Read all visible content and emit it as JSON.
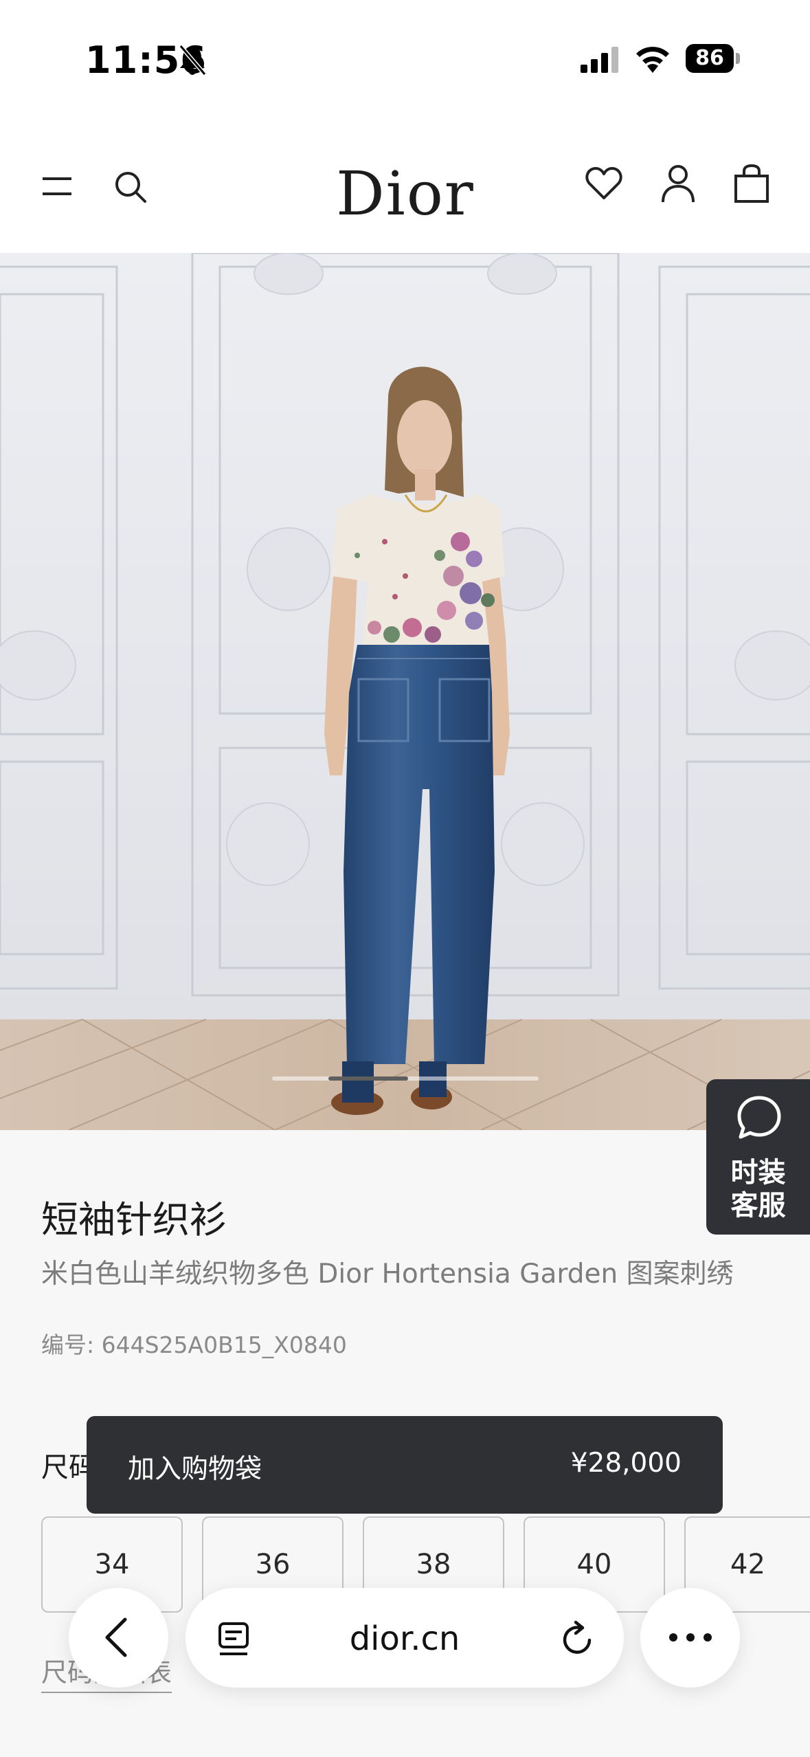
{
  "status_bar": {
    "time": "11:56",
    "battery": "86"
  },
  "header": {
    "logo": "Dior",
    "icons": [
      "menu-icon",
      "search-icon",
      "heart-icon",
      "user-icon",
      "bag-icon"
    ]
  },
  "hero": {
    "carousel_position": 0.3
  },
  "chat": {
    "label": "时装\n客服"
  },
  "product": {
    "title": "短袖针织衫",
    "description": "米白色山羊绒织物多色 Dior Hortensia Garden 图案刺绣",
    "sku": "编号: 644S25A0B15_X0840",
    "size_heading": "尺码",
    "sizes": [
      "34",
      "36",
      "38",
      "40",
      "42"
    ],
    "size_chart_link": "尺码对照表"
  },
  "cart": {
    "label": "加入购物袋",
    "price": "¥28,000"
  },
  "browser": {
    "url": "dior.cn"
  },
  "colors": {
    "accent_dark": "#2f3034",
    "background": "#f7f7f8"
  }
}
